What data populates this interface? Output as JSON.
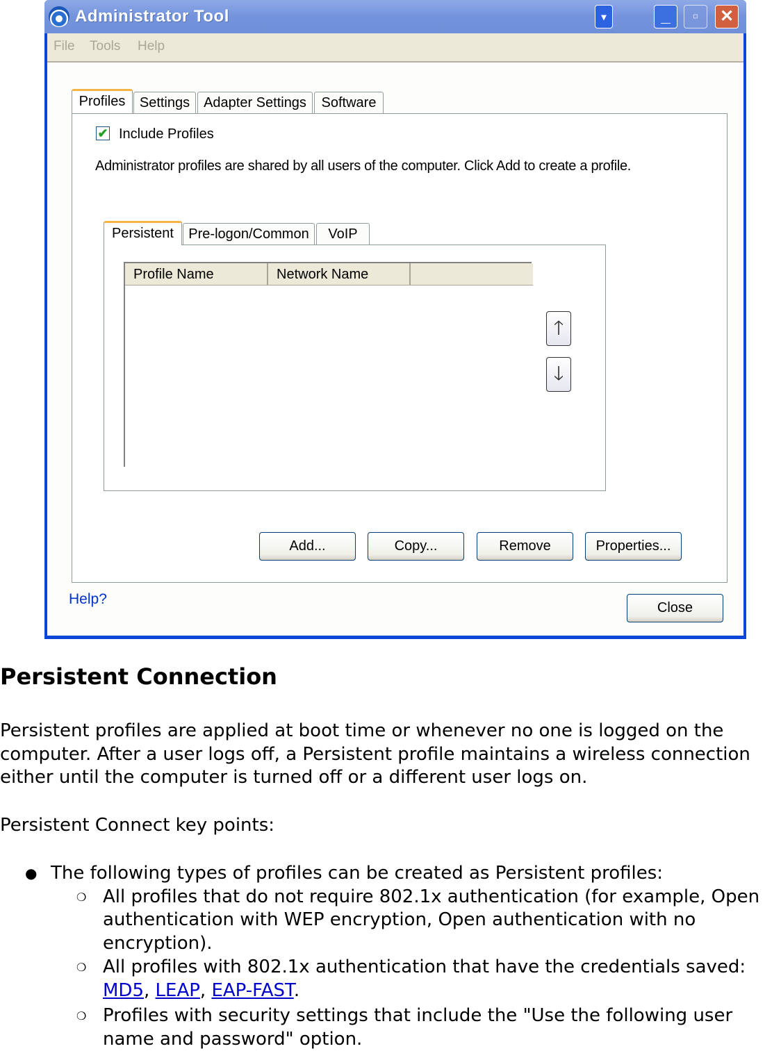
{
  "window": {
    "title": "Administrator Tool",
    "menu": [
      "File",
      "Tools",
      "Help"
    ],
    "controls": {
      "minimize": "minimize-icon",
      "maximize": "maximize-icon",
      "close": "close-icon"
    },
    "tabs": [
      "Profiles",
      "Settings",
      "Adapter Settings",
      "Software"
    ],
    "include_profiles": {
      "label": "Include Profiles",
      "checked": true
    },
    "description": "Administrator profiles are shared by all users of the computer. Click Add to create a profile.",
    "sub_tabs": [
      "Persistent",
      "Pre-logon/Common",
      "VoIP"
    ],
    "columns": [
      "Profile Name",
      "Network Name",
      ""
    ],
    "buttons": {
      "add": "Add...",
      "copy": "Copy...",
      "remove": "Remove",
      "properties": "Properties..."
    },
    "help": "Help?",
    "close": "Close"
  },
  "doc": {
    "heading": "Persistent Connection",
    "para1": "Persistent profiles are applied at boot time or whenever no one is logged on the computer. After a user logs off, a Persistent profile maintains a wireless connection either until the computer is turned off or a different user logs on.",
    "para2": "Persistent Connect key points:",
    "bullet1": "The following types of profiles can be created as Persistent profiles:",
    "sub1": "All profiles that do not require 802.1x authentication (for example, Open authentication with WEP encryption, Open authentication with no encryption).",
    "sub2_prefix": "All profiles with 802.1x authentication that have the credentials saved: ",
    "links": [
      "MD5",
      "LEAP",
      "EAP-FAST"
    ],
    "sep": ", ",
    "period": ".",
    "sub3": "Profiles with security settings that include the \"Use the following user name and password\" option."
  }
}
